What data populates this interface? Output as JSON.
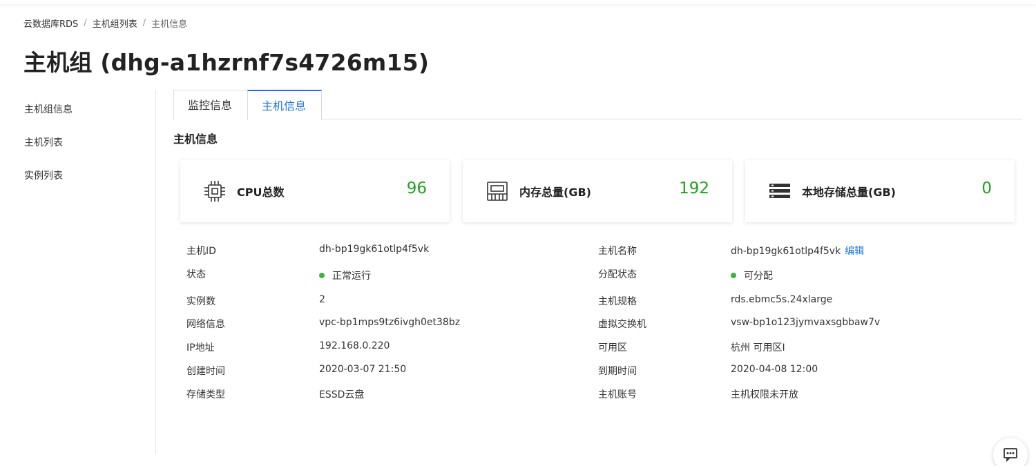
{
  "breadcrumb": {
    "items": [
      "云数据库RDS",
      "主机组列表",
      "主机信息"
    ],
    "separator": "/"
  },
  "page_title": "主机组 (dhg-a1hzrnf7s4726m15)",
  "sidebar": {
    "items": [
      {
        "label": "主机组信息"
      },
      {
        "label": "主机列表"
      },
      {
        "label": "实例列表"
      }
    ]
  },
  "tabs": [
    {
      "label": "监控信息",
      "active": false
    },
    {
      "label": "主机信息",
      "active": true
    }
  ],
  "section_title": "主机信息",
  "stats": [
    {
      "label": "CPU总数",
      "value": "96",
      "icon": "cpu-icon"
    },
    {
      "label": "内存总量(GB)",
      "value": "192",
      "icon": "memory-icon"
    },
    {
      "label": "本地存储总量(GB)",
      "value": "0",
      "icon": "storage-icon"
    }
  ],
  "info_left": [
    {
      "key": "主机ID",
      "value": "dh-bp19gk61otlp4f5vk"
    },
    {
      "key": "状态",
      "value": "正常运行",
      "status_dot": true
    },
    {
      "key": "实例数",
      "value": "2"
    },
    {
      "key": "网络信息",
      "value": "vpc-bp1mps9tz6ivgh0et38bz"
    },
    {
      "key": "IP地址",
      "value": "192.168.0.220"
    },
    {
      "key": "创建时间",
      "value": "2020-03-07 21:50"
    },
    {
      "key": "存储类型",
      "value": "ESSD云盘"
    }
  ],
  "info_right": [
    {
      "key": "主机名称",
      "value": "dh-bp19gk61otlp4f5vk",
      "link": "编辑"
    },
    {
      "key": "分配状态",
      "value": "可分配",
      "status_dot": true
    },
    {
      "key": "主机规格",
      "value": "rds.ebmc5s.24xlarge"
    },
    {
      "key": "虚拟交换机",
      "value": "vsw-bp1o123jymvaxsgbbaw7v"
    },
    {
      "key": "可用区",
      "value": "杭州 可用区I"
    },
    {
      "key": "到期时间",
      "value": "2020-04-08 12:00"
    },
    {
      "key": "主机账号",
      "value": "主机权限未开放"
    }
  ],
  "colors": {
    "accent": "#1a73e8",
    "success": "#1fa31f",
    "status_dot": "#3fb33f"
  },
  "chat_icon": "chat-icon"
}
